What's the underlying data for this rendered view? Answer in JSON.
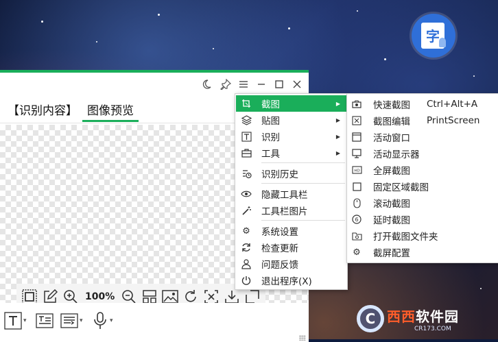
{
  "desktop": {
    "app_icon": {
      "glyph": "字",
      "icon": "ocr-app-icon"
    },
    "watermark": {
      "letter": "C",
      "brand_orange": "西西",
      "brand_white": "软件园",
      "url": "CR173.COM"
    }
  },
  "window": {
    "accent_color": "#1aae5a",
    "titlebar_icons": [
      "moon-icon",
      "pin-icon",
      "menu-icon",
      "minimize-icon",
      "maximize-icon",
      "close-icon"
    ],
    "tabs": [
      {
        "label": "【识别内容】",
        "active": false
      },
      {
        "label": "图像预览",
        "active": true
      }
    ],
    "image_toolbar": {
      "zoom": "100%",
      "icons": [
        "select-frame-icon",
        "edit-icon",
        "zoom-in-icon",
        "zoom-out-icon",
        "layout-icon",
        "image-icon",
        "rotate-icon",
        "crop-icon",
        "download-icon",
        "expand-icon"
      ]
    },
    "bottom_toolbar": {
      "icons": [
        "text-icon",
        "text-box-icon",
        "list-icon",
        "microphone-icon"
      ]
    }
  },
  "menu": {
    "items": [
      {
        "label": "截图",
        "icon": "screenshot-icon",
        "submenu": true,
        "selected": true
      },
      {
        "label": "贴图",
        "icon": "layers-icon",
        "submenu": true
      },
      {
        "label": "识别",
        "icon": "text-recognize-icon",
        "submenu": true
      },
      {
        "label": "工具",
        "icon": "toolbox-icon",
        "submenu": true
      },
      {
        "label": "识别历史",
        "icon": "history-icon"
      },
      {
        "label": "隐藏工具栏",
        "icon": "eye-icon"
      },
      {
        "label": "工具栏图片",
        "icon": "magic-wand-icon"
      },
      {
        "label": "系统设置",
        "icon": "gear-icon"
      },
      {
        "label": "检查更新",
        "icon": "refresh-icon"
      },
      {
        "label": "问题反馈",
        "icon": "user-feedback-icon"
      },
      {
        "label": "退出程序(X)",
        "icon": "power-icon"
      }
    ]
  },
  "submenu": {
    "items": [
      {
        "label": "快速截图",
        "shortcut": "Ctrl+Alt+A",
        "icon": "camera-icon"
      },
      {
        "label": "截图编辑",
        "shortcut": "PrintScreen",
        "icon": "edit-screenshot-icon"
      },
      {
        "label": "活动窗口",
        "shortcut": "",
        "icon": "window-icon"
      },
      {
        "label": "活动显示器",
        "shortcut": "",
        "icon": "monitor-icon"
      },
      {
        "label": "全屏截图",
        "shortcut": "",
        "icon": "fullscreen-icon"
      },
      {
        "label": "固定区域截图",
        "shortcut": "",
        "icon": "square-icon"
      },
      {
        "label": "滚动截图",
        "shortcut": "",
        "icon": "mouse-icon"
      },
      {
        "label": "延时截图",
        "shortcut": "",
        "icon": "timer-icon"
      },
      {
        "label": "打开截图文件夹",
        "shortcut": "",
        "icon": "folder-camera-icon"
      },
      {
        "label": "截屏配置",
        "shortcut": "",
        "icon": "gear-icon"
      }
    ]
  }
}
